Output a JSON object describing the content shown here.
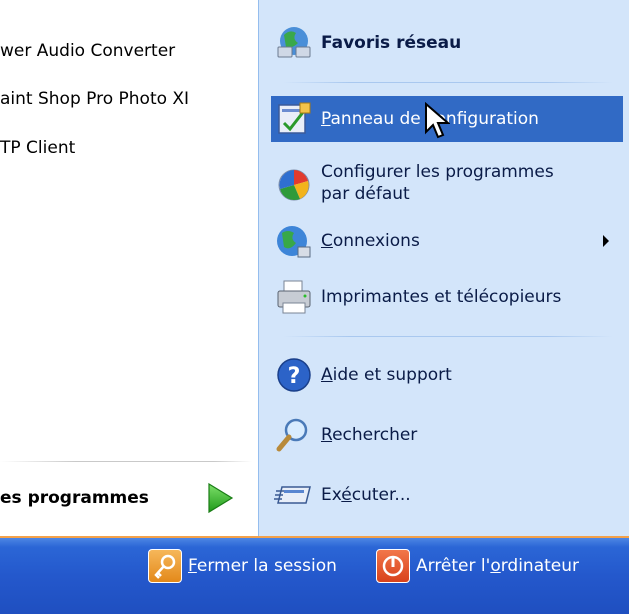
{
  "left_pane": {
    "programs": [
      {
        "label": "wer Audio Converter"
      },
      {
        "label": "aint Shop Pro Photo XI"
      },
      {
        "label": "TP Client"
      }
    ],
    "all_programs_label": "es programmes"
  },
  "right_pane": {
    "items": [
      {
        "label": "Favoris réseau"
      },
      {
        "label_prefix": "",
        "label_u": "P",
        "label_rest": "anneau de configuration"
      },
      {
        "label_line1": "Configurer les programmes",
        "label_line2": "par défaut"
      },
      {
        "label_u": "C",
        "label_rest": "onnexions"
      },
      {
        "label": "Imprimantes et télécopieurs"
      },
      {
        "label_u": "A",
        "label_rest": "ide et support"
      },
      {
        "label_u": "R",
        "label_rest": "echercher"
      },
      {
        "label_prefix": "Ex",
        "label_u": "é",
        "label_rest": "cuter..."
      }
    ]
  },
  "bottom_bar": {
    "logoff_u": "F",
    "logoff_rest": "ermer la session",
    "shutdown_prefix": "Arrêter l'",
    "shutdown_u": "o",
    "shutdown_rest": "rdinateur"
  },
  "colors": {
    "right_pane_bg": "#d3e5fa",
    "highlight": "#316ac5",
    "bottom_bar": "#2458cc",
    "accent_orange": "#f3a14a"
  },
  "icons": [
    "network-places-icon",
    "control-panel-icon",
    "default-programs-icon",
    "connections-icon",
    "printers-icon",
    "help-icon",
    "search-icon",
    "run-icon",
    "logoff-key-icon",
    "power-icon",
    "all-programs-arrow-icon"
  ]
}
